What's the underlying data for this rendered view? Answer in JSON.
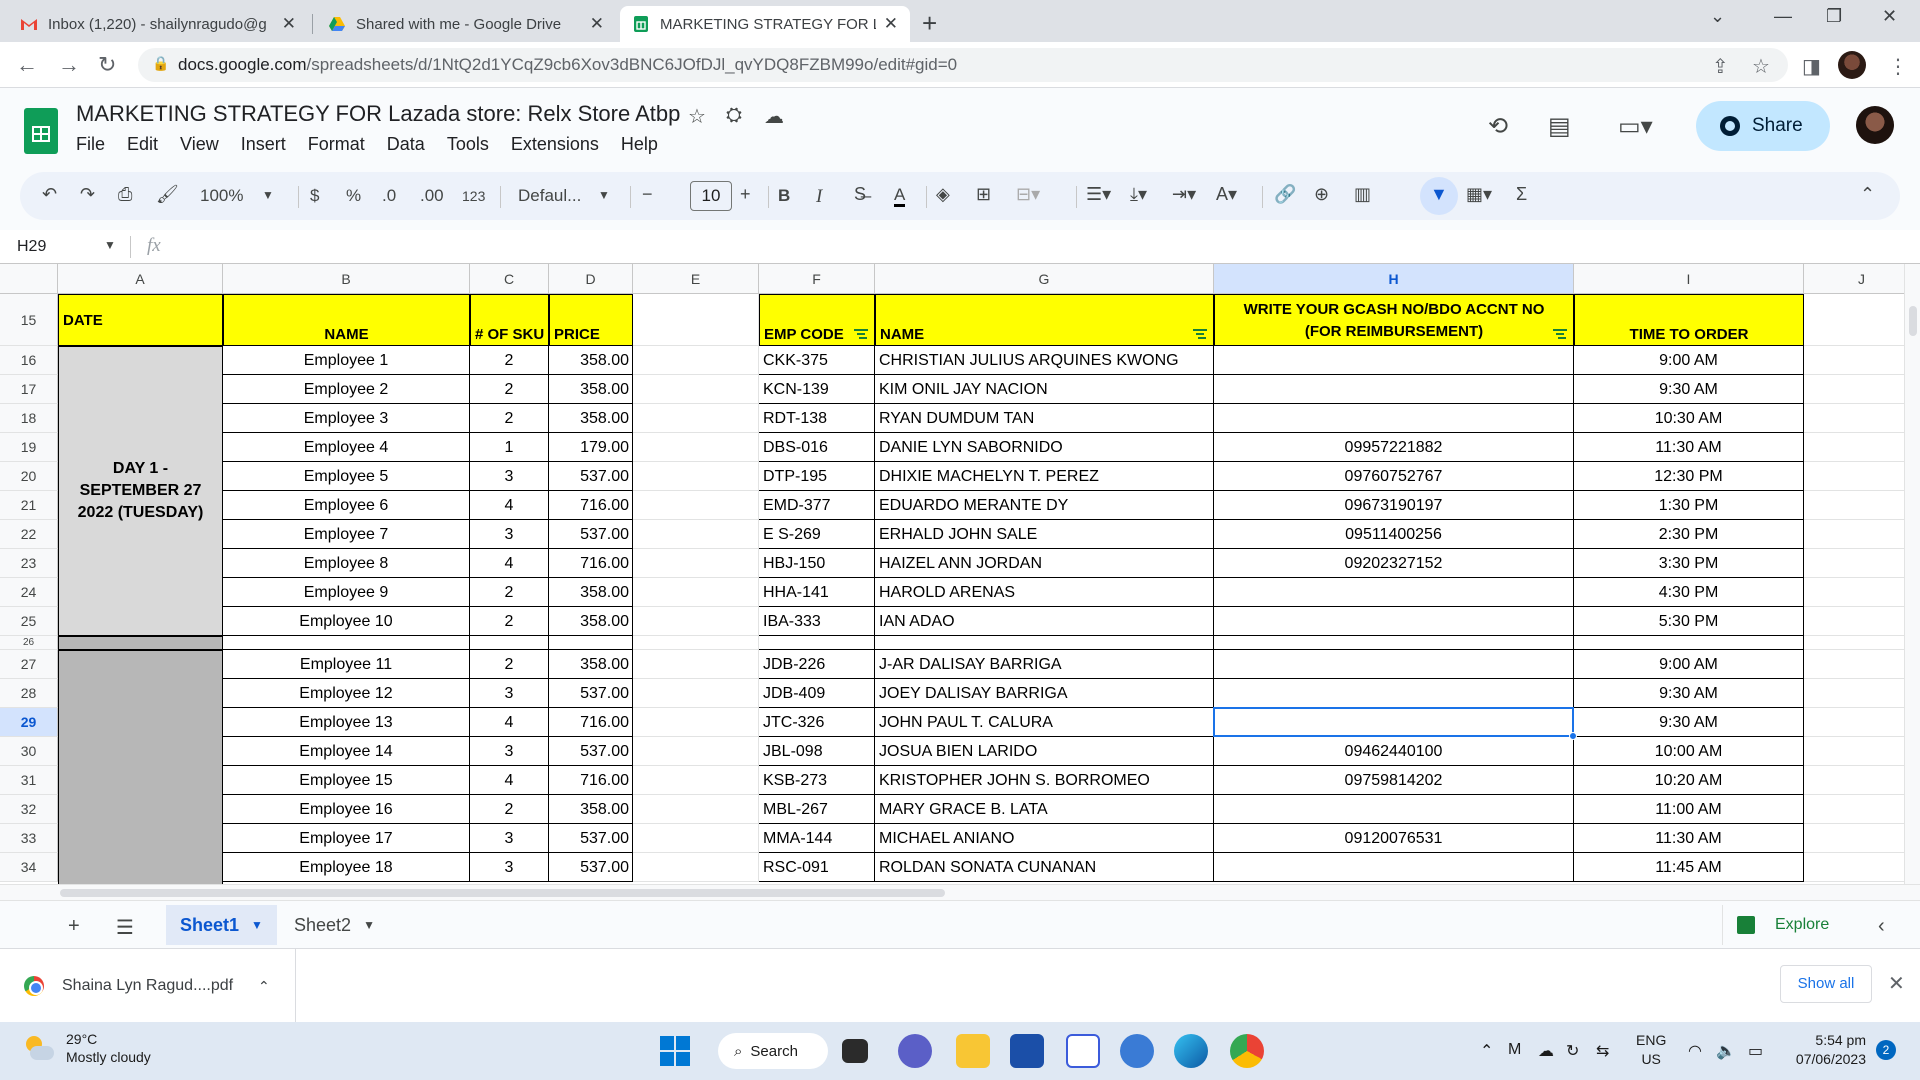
{
  "browser": {
    "tabs": [
      {
        "title": "Inbox (1,220) - shailynragudo@g",
        "icon": "gmail-icon"
      },
      {
        "title": "Shared with me - Google Drive",
        "icon": "drive-icon"
      },
      {
        "title": "MARKETING STRATEGY FOR Laza",
        "icon": "sheets-icon",
        "active": true
      }
    ],
    "url_host": "docs.google.com",
    "url_path": "/spreadsheets/d/1NtQ2d1YCqZ9cb6Xov3dBNC6JOfDJl_qvYDQ8FZBM99o/edit#gid=0"
  },
  "doc": {
    "title": "MARKETING STRATEGY FOR Lazada store: Relx Store Atbp",
    "menu": [
      "File",
      "Edit",
      "View",
      "Insert",
      "Format",
      "Data",
      "Tools",
      "Extensions",
      "Help"
    ],
    "share_label": "Share"
  },
  "toolbar": {
    "zoom": "100%",
    "currency": "$",
    "percent": "%",
    "dec_decrease": ".0",
    "dec_increase": ".00",
    "number_format": "123",
    "font": "Defaul...",
    "font_size": "10",
    "bold": "B",
    "italic": "I",
    "text_color": "A"
  },
  "formula_bar": {
    "cell_ref": "H29",
    "fx": "fx",
    "value": ""
  },
  "grid": {
    "columns": [
      "A",
      "B",
      "C",
      "D",
      "E",
      "F",
      "G",
      "H",
      "I",
      "J"
    ],
    "selected_column": "H",
    "selected_row": "29",
    "header_row": "15",
    "headers": {
      "date": "DATE",
      "name": "NAME",
      "sku": "# OF SKU",
      "price": "PRICE",
      "emp_code": "EMP CODE",
      "emp_name": "NAME",
      "gcash_line1": "WRITE YOUR GCASH NO/BDO ACCNT NO",
      "gcash_line2": "(FOR REIMBURSEMENT)",
      "time": "TIME TO ORDER"
    },
    "day1_label": "DAY 1 - SEPTEMBER 27 2022 (TUESDAY)",
    "rows": [
      {
        "row": "16",
        "name": "Employee 1",
        "sku": "2",
        "price": "358.00",
        "code": "CKK-375",
        "emp": "CHRISTIAN JULIUS ARQUINES KWONG",
        "gcash": "",
        "time": "9:00 AM"
      },
      {
        "row": "17",
        "name": "Employee 2",
        "sku": "2",
        "price": "358.00",
        "code": "KCN-139",
        "emp": "KIM ONIL JAY NACION",
        "gcash": "",
        "time": "9:30 AM"
      },
      {
        "row": "18",
        "name": "Employee 3",
        "sku": "2",
        "price": "358.00",
        "code": "RDT-138",
        "emp": "RYAN DUMDUM TAN",
        "gcash": "",
        "time": "10:30 AM"
      },
      {
        "row": "19",
        "name": "Employee 4",
        "sku": "1",
        "price": "179.00",
        "code": "DBS-016",
        "emp": "DANIE LYN SABORNIDO",
        "gcash": "09957221882",
        "time": "11:30 AM"
      },
      {
        "row": "20",
        "name": "Employee 5",
        "sku": "3",
        "price": "537.00",
        "code": "DTP-195",
        "emp": "DHIXIE MACHELYN T. PEREZ",
        "gcash": "09760752767",
        "time": "12:30 PM"
      },
      {
        "row": "21",
        "name": "Employee 6",
        "sku": "4",
        "price": "716.00",
        "code": "EMD-377",
        "emp": "EDUARDO MERANTE DY",
        "gcash": "09673190197",
        "time": "1:30 PM"
      },
      {
        "row": "22",
        "name": "Employee 7",
        "sku": "3",
        "price": "537.00",
        "code": "E S-269",
        "emp": "ERHALD JOHN SALE",
        "gcash": "09511400256",
        "time": "2:30 PM"
      },
      {
        "row": "23",
        "name": "Employee 8",
        "sku": "4",
        "price": "716.00",
        "code": "HBJ-150",
        "emp": "HAIZEL ANN JORDAN",
        "gcash": "09202327152",
        "time": "3:30 PM"
      },
      {
        "row": "24",
        "name": "Employee 9",
        "sku": "2",
        "price": "358.00",
        "code": "HHA-141",
        "emp": "HAROLD ARENAS",
        "gcash": "",
        "time": "4:30 PM"
      },
      {
        "row": "25",
        "name": "Employee 10",
        "sku": "2",
        "price": "358.00",
        "code": "IBA-333",
        "emp": "IAN ADAO",
        "gcash": "",
        "time": "5:30 PM"
      },
      {
        "row": "26",
        "name": "",
        "sku": "",
        "price": "",
        "code": "",
        "emp": "",
        "gcash": "",
        "time": ""
      },
      {
        "row": "27",
        "name": "Employee 11",
        "sku": "2",
        "price": "358.00",
        "code": "JDB-226",
        "emp": "J-AR DALISAY BARRIGA",
        "gcash": "",
        "time": "9:00 AM"
      },
      {
        "row": "28",
        "name": "Employee 12",
        "sku": "3",
        "price": "537.00",
        "code": "JDB-409",
        "emp": "JOEY DALISAY BARRIGA",
        "gcash": "",
        "time": "9:30 AM"
      },
      {
        "row": "29",
        "name": "Employee 13",
        "sku": "4",
        "price": "716.00",
        "code": "JTC-326",
        "emp": "JOHN PAUL T. CALURA",
        "gcash": "",
        "time": "9:30 AM"
      },
      {
        "row": "30",
        "name": "Employee 14",
        "sku": "3",
        "price": "537.00",
        "code": "JBL-098",
        "emp": "JOSUA BIEN LARIDO",
        "gcash": "09462440100",
        "time": "10:00 AM"
      },
      {
        "row": "31",
        "name": "Employee 15",
        "sku": "4",
        "price": "716.00",
        "code": "KSB-273",
        "emp": "KRISTOPHER JOHN S. BORROMEO",
        "gcash": "09759814202",
        "time": "10:20 AM"
      },
      {
        "row": "32",
        "name": "Employee 16",
        "sku": "2",
        "price": "358.00",
        "code": "MBL-267",
        "emp": "MARY GRACE B. LATA",
        "gcash": "",
        "time": "11:00 AM"
      },
      {
        "row": "33",
        "name": "Employee 17",
        "sku": "3",
        "price": "537.00",
        "code": "MMA-144",
        "emp": "MICHAEL ANIANO",
        "gcash": "09120076531",
        "time": "11:30 AM"
      },
      {
        "row": "34",
        "name": "Employee 18",
        "sku": "3",
        "price": "537.00",
        "code": "RSC-091",
        "emp": "ROLDAN SONATA CUNANAN",
        "gcash": "",
        "time": "11:45 AM"
      }
    ]
  },
  "sheet_tabs": {
    "tabs": [
      "Sheet1",
      "Sheet2"
    ],
    "active": "Sheet1",
    "explore": "Explore"
  },
  "downloads": {
    "file": "Shaina Lyn Ragud....pdf",
    "show_all": "Show all"
  },
  "taskbar": {
    "temp": "29°C",
    "weather": "Mostly cloudy",
    "search": "Search",
    "lang1": "ENG",
    "lang2": "US",
    "time": "5:54 pm",
    "date": "07/06/2023",
    "notifications": "2"
  },
  "colors": {
    "header_yellow": "#ffff00",
    "selection_blue": "#1a73e8",
    "share_bg": "#c2e7ff"
  }
}
